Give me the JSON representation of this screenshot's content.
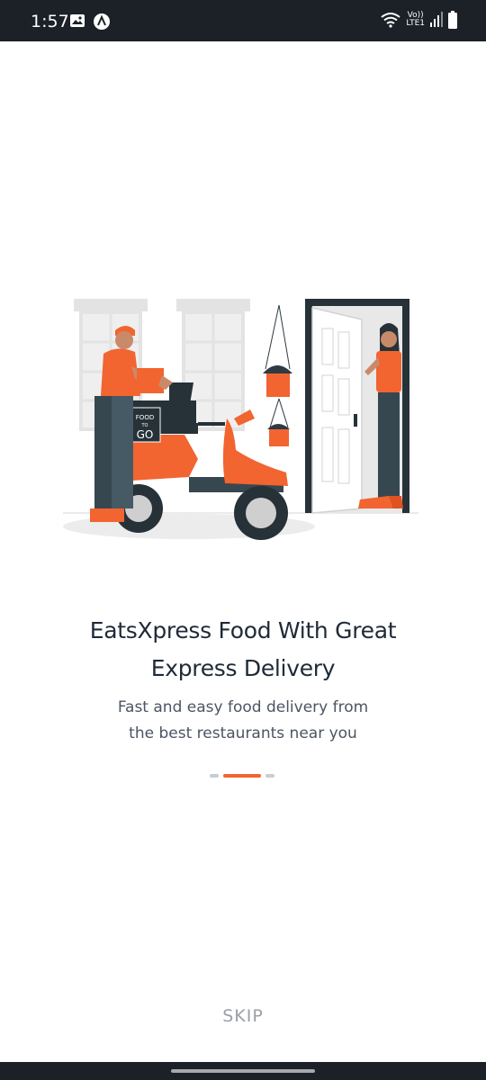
{
  "status_bar": {
    "time": "1:57",
    "network_top": "Vo))",
    "network_bottom": "LTE1",
    "icons": [
      "image-icon",
      "app-a-icon",
      "wifi-icon",
      "signal-icon",
      "battery-icon"
    ]
  },
  "illustration": {
    "box_text_top": "FOOD",
    "box_text_mid": "TO",
    "box_text_bottom": "GO",
    "accent_color": "#f26430"
  },
  "onboarding": {
    "title_line1": "EatsXpress Food With Great",
    "title_line2": "Express Delivery",
    "subtitle_line1": "Fast and easy food delivery from",
    "subtitle_line2": "the best restaurants near you",
    "page_count": 3,
    "active_page": 2
  },
  "actions": {
    "skip_label": "SKIP"
  },
  "colors": {
    "status_bar": "#1c2027",
    "accent": "#f26430",
    "title_text": "#1f2a37",
    "subtitle_text": "#4b5563",
    "skip_text": "#9aa0a8"
  }
}
